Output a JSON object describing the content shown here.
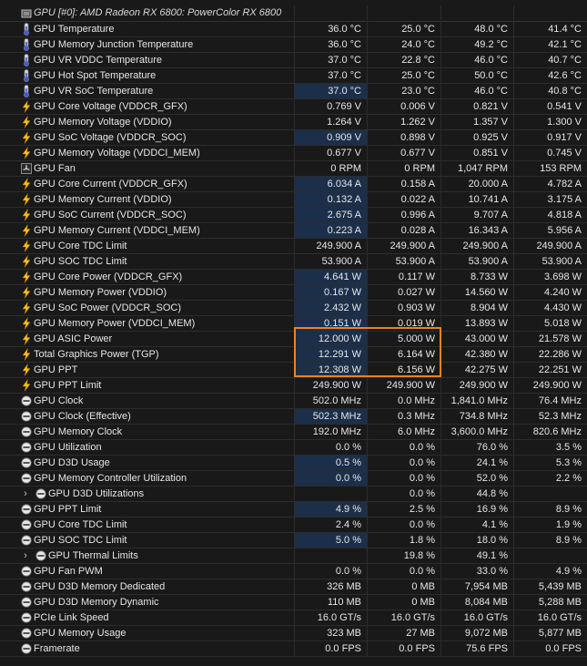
{
  "header": {
    "title": "GPU [#0]: AMD Radeon RX 6800: PowerColor RX 6800",
    "icon": "gpu-chip-icon"
  },
  "colors": {
    "accent_bar": "#1c2f4a",
    "highlight_box": "#f0821e",
    "background": "#191919"
  },
  "rows": [
    {
      "label": "GPU Temperature",
      "icon": "thermometer",
      "v": [
        "36.0 °C",
        "25.0 °C",
        "48.0 °C",
        "41.4 °C"
      ]
    },
    {
      "label": "GPU Memory Junction Temperature",
      "icon": "thermometer",
      "v": [
        "36.0 °C",
        "24.0 °C",
        "49.2 °C",
        "42.1 °C"
      ]
    },
    {
      "label": "GPU VR VDDC Temperature",
      "icon": "thermometer",
      "v": [
        "37.0 °C",
        "22.8 °C",
        "46.0 °C",
        "40.7 °C"
      ]
    },
    {
      "label": "GPU Hot Spot Temperature",
      "icon": "thermometer",
      "v": [
        "37.0 °C",
        "25.0 °C",
        "50.0 °C",
        "42.6 °C"
      ]
    },
    {
      "label": "GPU VR SoC Temperature",
      "icon": "thermometer",
      "v": [
        "37.0 °C",
        "23.0 °C",
        "46.0 °C",
        "40.8 °C"
      ],
      "bar": 1
    },
    {
      "label": "GPU Core Voltage (VDDCR_GFX)",
      "icon": "lightning",
      "v": [
        "0.769 V",
        "0.006 V",
        "0.821 V",
        "0.541 V"
      ]
    },
    {
      "label": "GPU Memory Voltage (VDDIO)",
      "icon": "lightning",
      "v": [
        "1.264 V",
        "1.262 V",
        "1.357 V",
        "1.300 V"
      ]
    },
    {
      "label": "GPU SoC Voltage (VDDCR_SOC)",
      "icon": "lightning",
      "v": [
        "0.909 V",
        "0.898 V",
        "0.925 V",
        "0.917 V"
      ],
      "bar": 1
    },
    {
      "label": "GPU Memory Voltage (VDDCI_MEM)",
      "icon": "lightning",
      "v": [
        "0.677 V",
        "0.677 V",
        "0.851 V",
        "0.745 V"
      ]
    },
    {
      "label": "GPU Fan",
      "icon": "fan",
      "v": [
        "0 RPM",
        "0 RPM",
        "1,047 RPM",
        "153 RPM"
      ]
    },
    {
      "label": "GPU Core Current (VDDCR_GFX)",
      "icon": "lightning",
      "v": [
        "6.034 A",
        "0.158 A",
        "20.000 A",
        "4.782 A"
      ],
      "bar": 1
    },
    {
      "label": "GPU Memory Current (VDDIO)",
      "icon": "lightning",
      "v": [
        "0.132 A",
        "0.022 A",
        "10.741 A",
        "3.175 A"
      ],
      "bar": 1
    },
    {
      "label": "GPU SoC Current (VDDCR_SOC)",
      "icon": "lightning",
      "v": [
        "2.675 A",
        "0.996 A",
        "9.707 A",
        "4.818 A"
      ],
      "bar": 1
    },
    {
      "label": "GPU Memory Current (VDDCI_MEM)",
      "icon": "lightning",
      "v": [
        "0.223 A",
        "0.028 A",
        "16.343 A",
        "5.956 A"
      ],
      "bar": 1
    },
    {
      "label": "GPU Core TDC Limit",
      "icon": "lightning",
      "v": [
        "249.900 A",
        "249.900 A",
        "249.900 A",
        "249.900 A"
      ]
    },
    {
      "label": "GPU SOC TDC Limit",
      "icon": "lightning",
      "v": [
        "53.900 A",
        "53.900 A",
        "53.900 A",
        "53.900 A"
      ]
    },
    {
      "label": "GPU Core Power (VDDCR_GFX)",
      "icon": "lightning",
      "v": [
        "4.641 W",
        "0.117 W",
        "8.733 W",
        "3.698 W"
      ],
      "bar": 1
    },
    {
      "label": "GPU Memory Power (VDDIO)",
      "icon": "lightning",
      "v": [
        "0.167 W",
        "0.027 W",
        "14.560 W",
        "4.240 W"
      ],
      "bar": 1
    },
    {
      "label": "GPU SoC Power (VDDCR_SOC)",
      "icon": "lightning",
      "v": [
        "2.432 W",
        "0.903 W",
        "8.904 W",
        "4.430 W"
      ],
      "bar": 1
    },
    {
      "label": "GPU Memory Power (VDDCI_MEM)",
      "icon": "lightning",
      "v": [
        "0.151 W",
        "0.019 W",
        "13.893 W",
        "5.018 W"
      ],
      "bar": 1
    },
    {
      "label": "GPU ASIC Power",
      "icon": "lightning",
      "v": [
        "12.000 W",
        "5.000 W",
        "43.000 W",
        "21.578 W"
      ],
      "bar": 1
    },
    {
      "label": "Total Graphics Power (TGP)",
      "icon": "lightning",
      "v": [
        "12.291 W",
        "6.164 W",
        "42.380 W",
        "22.286 W"
      ],
      "bar": 1
    },
    {
      "label": "GPU PPT",
      "icon": "lightning",
      "v": [
        "12.308 W",
        "6.156 W",
        "42.275 W",
        "22.251 W"
      ],
      "bar": 1
    },
    {
      "label": "GPU PPT Limit",
      "icon": "lightning",
      "v": [
        "249.900 W",
        "249.900 W",
        "249.900 W",
        "249.900 W"
      ]
    },
    {
      "label": "GPU Clock",
      "icon": "gauge",
      "v": [
        "502.0 MHz",
        "0.0 MHz",
        "1,841.0 MHz",
        "76.4 MHz"
      ]
    },
    {
      "label": "GPU Clock (Effective)",
      "icon": "gauge",
      "v": [
        "502.3 MHz",
        "0.3 MHz",
        "734.8 MHz",
        "52.3 MHz"
      ],
      "bar": 1
    },
    {
      "label": "GPU Memory Clock",
      "icon": "gauge",
      "v": [
        "192.0 MHz",
        "6.0 MHz",
        "3,600.0 MHz",
        "820.6 MHz"
      ]
    },
    {
      "label": "GPU Utilization",
      "icon": "gauge",
      "v": [
        "0.0 %",
        "0.0 %",
        "76.0 %",
        "3.5 %"
      ]
    },
    {
      "label": "GPU D3D Usage",
      "icon": "gauge",
      "v": [
        "0.5 %",
        "0.0 %",
        "24.1 %",
        "5.3 %"
      ],
      "bar": 1
    },
    {
      "label": "GPU Memory Controller Utilization",
      "icon": "gauge",
      "v": [
        "0.0 %",
        "0.0 %",
        "52.0 %",
        "2.2 %"
      ],
      "bar": 1
    },
    {
      "label": "GPU D3D Utilizations",
      "icon": "gauge",
      "sub": 1,
      "v": [
        "",
        "0.0 %",
        "44.8 %",
        ""
      ]
    },
    {
      "label": "GPU PPT Limit",
      "icon": "gauge",
      "v": [
        "4.9 %",
        "2.5 %",
        "16.9 %",
        "8.9 %"
      ],
      "bar": 1
    },
    {
      "label": "GPU Core TDC Limit",
      "icon": "gauge",
      "v": [
        "2.4 %",
        "0.0 %",
        "4.1 %",
        "1.9 %"
      ]
    },
    {
      "label": "GPU SOC TDC Limit",
      "icon": "gauge",
      "v": [
        "5.0 %",
        "1.8 %",
        "18.0 %",
        "8.9 %"
      ],
      "bar": 1
    },
    {
      "label": "GPU Thermal Limits",
      "icon": "gauge",
      "sub": 1,
      "v": [
        "",
        "19.8 %",
        "49.1 %",
        ""
      ]
    },
    {
      "label": "GPU Fan PWM",
      "icon": "gauge",
      "v": [
        "0.0 %",
        "0.0 %",
        "33.0 %",
        "4.9 %"
      ]
    },
    {
      "label": "GPU D3D Memory Dedicated",
      "icon": "gauge",
      "v": [
        "326 MB",
        "0 MB",
        "7,954 MB",
        "5,439 MB"
      ]
    },
    {
      "label": "GPU D3D Memory Dynamic",
      "icon": "gauge",
      "v": [
        "110 MB",
        "0 MB",
        "8,084 MB",
        "5,288 MB"
      ]
    },
    {
      "label": "PCIe Link Speed",
      "icon": "gauge",
      "v": [
        "16.0 GT/s",
        "16.0 GT/s",
        "16.0 GT/s",
        "16.0 GT/s"
      ]
    },
    {
      "label": "GPU Memory Usage",
      "icon": "gauge",
      "v": [
        "323 MB",
        "27 MB",
        "9,072 MB",
        "5,877 MB"
      ]
    },
    {
      "label": "Framerate",
      "icon": "gauge",
      "v": [
        "0.0 FPS",
        "0.0 FPS",
        "75.6 FPS",
        "0.0 FPS"
      ]
    }
  ]
}
